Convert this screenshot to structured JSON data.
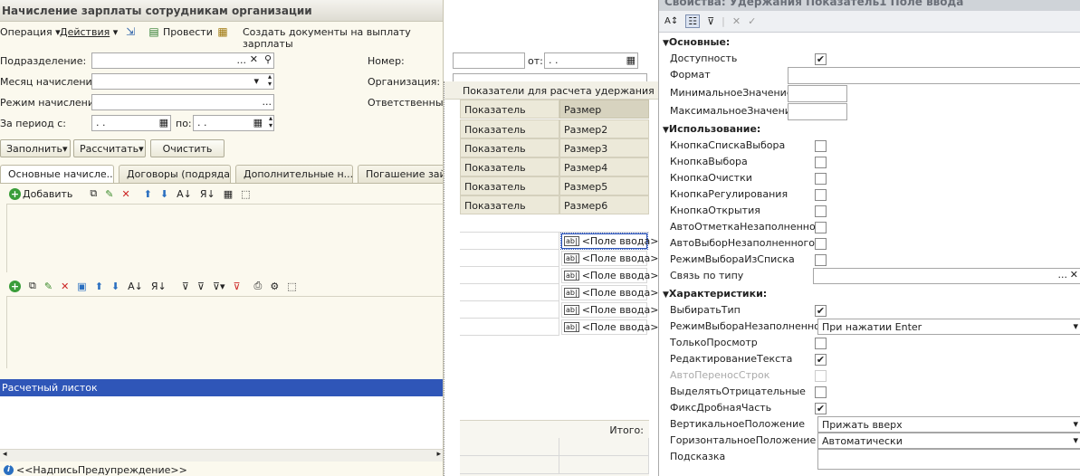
{
  "window": {
    "title": "Начисление зарплаты сотрудникам организации"
  },
  "toolbar": {
    "operation": "Операция",
    "actions": "Действия",
    "post": "Провести",
    "create_docs": "Создать документы на выплату зарплаты"
  },
  "form": {
    "division_label": "Подразделение:",
    "month_label": "Месяц начисления:",
    "mode_label": "Режим начисления:",
    "period_label": "За период с:",
    "period_to_label": "по:",
    "date_placeholder": " .  .",
    "number_label": "Номер:",
    "from_label": "от:",
    "org_label": "Организация:",
    "responsible_label": "Ответственный:"
  },
  "actions": {
    "fill": "Заполнить",
    "calc": "Рассчитать",
    "clear": "Очистить"
  },
  "tabs": [
    "Основные начисле...",
    "Договоры (подряда)",
    "Дополнительные н...",
    "Погашение займ"
  ],
  "subtoolbar": {
    "add": "Добавить"
  },
  "payslip": {
    "title": "Расчетный листок",
    "warning": "<<НадписьПредупреждение>>"
  },
  "grid": {
    "title": "Показатели для расчета удержания",
    "headers": [
      "Показатель",
      "Размер"
    ],
    "rows": [
      [
        "Показатель",
        "Размер2"
      ],
      [
        "Показатель",
        "Размер3"
      ],
      [
        "Показатель",
        "Размер4"
      ],
      [
        "Показатель",
        "Размер5"
      ],
      [
        "Показатель",
        "Размер6"
      ]
    ],
    "input_fields": [
      "<Поле ввода>",
      "<Поле ввода>",
      "<Поле ввода>",
      "<Поле ввода>",
      "<Поле ввода>",
      "<Поле ввода>"
    ],
    "total_label": "Итого:"
  },
  "properties": {
    "title": "Свойства: Удержания Показатель1 Поле ввода",
    "sections": {
      "basic": "Основные:",
      "usage": "Использование:",
      "traits": "Характеристики:"
    },
    "basic": [
      {
        "label": "Доступность",
        "checked": true
      },
      {
        "label": "Формат"
      },
      {
        "label": "МинимальноеЗначение"
      },
      {
        "label": "МаксимальноеЗначение"
      }
    ],
    "usage": [
      {
        "label": "КнопкаСпискаВыбора",
        "checked": false
      },
      {
        "label": "КнопкаВыбора",
        "checked": false
      },
      {
        "label": "КнопкаОчистки",
        "checked": false
      },
      {
        "label": "КнопкаРегулирования",
        "checked": false
      },
      {
        "label": "КнопкаОткрытия",
        "checked": false
      },
      {
        "label": "АвтоОтметкаНезаполненного",
        "checked": false
      },
      {
        "label": "АвтоВыборНезаполненного",
        "checked": false
      },
      {
        "label": "РежимВыбораИзСписка",
        "checked": false
      },
      {
        "label": "Связь по типу"
      }
    ],
    "traits": [
      {
        "label": "ВыбиратьТип",
        "checked": true
      },
      {
        "label": "РежимВыбораНезаполненного",
        "value": "При нажатии Enter"
      },
      {
        "label": "ТолькоПросмотр",
        "checked": false
      },
      {
        "label": "РедактированиеТекста",
        "checked": true
      },
      {
        "label": "АвтоПереносСтрок",
        "checked": false
      },
      {
        "label": "ВыделятьОтрицательные",
        "checked": false
      },
      {
        "label": "ФиксДробнаяЧасть",
        "checked": true
      },
      {
        "label": "ВертикальноеПоложение",
        "value": "Прижать вверх"
      },
      {
        "label": "ГоризонтальноеПоложение",
        "value": "Автоматически"
      },
      {
        "label": "Подсказка"
      }
    ]
  }
}
